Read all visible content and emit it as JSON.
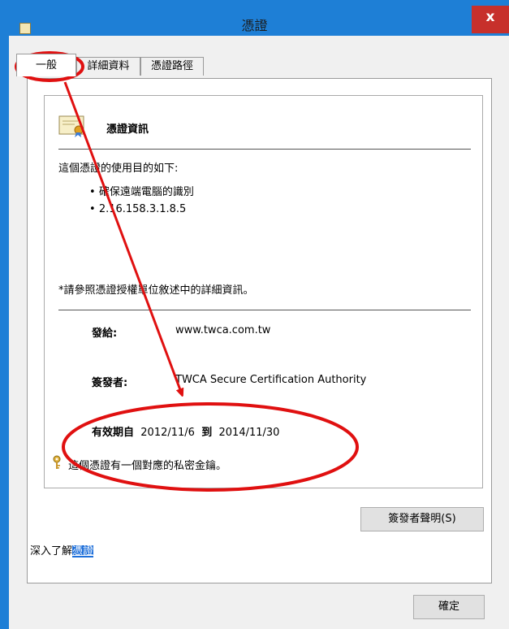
{
  "window": {
    "title": "憑證",
    "close_label": "x"
  },
  "tabs": [
    {
      "label": "一般",
      "active": true
    },
    {
      "label": "詳細資料",
      "active": false
    },
    {
      "label": "憑證路徑",
      "active": false
    }
  ],
  "cert_info": {
    "heading": "憑證資訊",
    "purpose_intro": "這個憑證的使用目的如下:",
    "purposes": [
      "確保遠端電腦的識別",
      "2.16.158.3.1.8.5"
    ],
    "note": "*請參照憑證授權單位敘述中的詳細資訊。",
    "issued_to_label": "發給:",
    "issued_to_value": "www.twca.com.tw",
    "issued_by_label": "簽發者:",
    "issued_by_value": "TWCA Secure Certification Authority",
    "validity_prefix": "有效期自",
    "valid_from": "2012/11/6",
    "validity_to": "到",
    "valid_to": "2014/11/30",
    "private_key_note": "這個憑證有一個對應的私密金鑰。"
  },
  "buttons": {
    "issuer_statement": "簽發者聲明(S)",
    "ok": "確定"
  },
  "learn_more": {
    "prefix": "深入了解",
    "link": "憑證"
  },
  "colors": {
    "titlebar": "#1e7fd6",
    "close": "#c7302b",
    "annotation": "#e01010"
  }
}
